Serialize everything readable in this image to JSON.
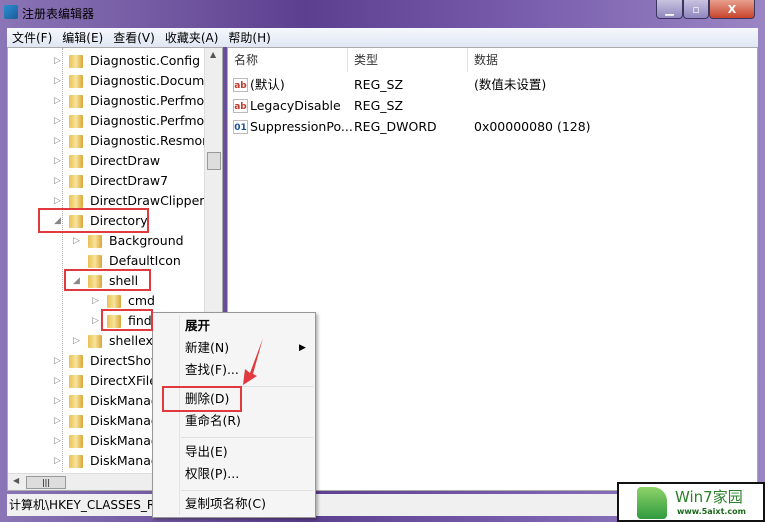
{
  "window": {
    "title": "注册表编辑器",
    "controls": [
      "minimize",
      "maximize",
      "close"
    ]
  },
  "menu": [
    "文件(F)",
    "编辑(E)",
    "查看(V)",
    "收藏夹(A)",
    "帮助(H)"
  ],
  "tree": [
    {
      "label": "Diagnostic.Config",
      "level": 0,
      "state": "collapsed"
    },
    {
      "label": "Diagnostic.Documer",
      "level": 0,
      "state": "collapsed"
    },
    {
      "label": "Diagnostic.Perfmon",
      "level": 0,
      "state": "collapsed"
    },
    {
      "label": "Diagnostic.Perfmon",
      "level": 0,
      "state": "collapsed"
    },
    {
      "label": "Diagnostic.Resmon.",
      "level": 0,
      "state": "collapsed"
    },
    {
      "label": "DirectDraw",
      "level": 0,
      "state": "collapsed"
    },
    {
      "label": "DirectDraw7",
      "level": 0,
      "state": "collapsed"
    },
    {
      "label": "DirectDrawClipper",
      "level": 0,
      "state": "collapsed"
    },
    {
      "label": "Directory",
      "level": 0,
      "state": "expanded"
    },
    {
      "label": "Background",
      "level": 1,
      "state": "collapsed"
    },
    {
      "label": "DefaultIcon",
      "level": 1,
      "state": "none"
    },
    {
      "label": "shell",
      "level": 1,
      "state": "expanded"
    },
    {
      "label": "cmd",
      "level": 2,
      "state": "collapsed"
    },
    {
      "label": "find",
      "level": 2,
      "state": "collapsed",
      "selected": true
    },
    {
      "label": "shellex",
      "level": 1,
      "state": "collapsed"
    },
    {
      "label": "DirectShow",
      "level": 0,
      "state": "collapsed"
    },
    {
      "label": "DirectXFile",
      "level": 0,
      "state": "collapsed"
    },
    {
      "label": "DiskManag",
      "level": 0,
      "state": "collapsed"
    },
    {
      "label": "DiskManag",
      "level": 0,
      "state": "collapsed"
    },
    {
      "label": "DiskManag",
      "level": 0,
      "state": "collapsed"
    },
    {
      "label": "DiskManag",
      "level": 0,
      "state": "collapsed"
    }
  ],
  "list": {
    "columns": [
      "名称",
      "类型",
      "数据"
    ],
    "rows": [
      {
        "icon": "string-value-icon",
        "name": "(默认)",
        "type": "REG_SZ",
        "data": "(数值未设置)"
      },
      {
        "icon": "string-value-icon",
        "name": "LegacyDisable",
        "type": "REG_SZ",
        "data": ""
      },
      {
        "icon": "binary-value-icon",
        "name": "SuppressionPo...",
        "type": "REG_DWORD",
        "data": "0x00000080 (128)"
      }
    ]
  },
  "status": "计算机\\HKEY_CLASSES_RO",
  "context_menu": [
    "展开",
    "新建(N)",
    "查找(F)...",
    "删除(D)",
    "重命名(R)",
    "导出(E)",
    "权限(P)...",
    "复制项名称(C)"
  ],
  "watermark": {
    "brand": "Win7家园",
    "url": "www.5aixt.com"
  },
  "colors": {
    "highlight": "#e0393e",
    "frame": "#6a4f9a"
  }
}
